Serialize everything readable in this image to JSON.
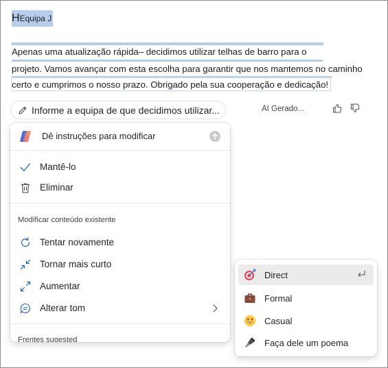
{
  "document": {
    "title_initial": "H",
    "title_rest": "Equipa J",
    "lines": [
      "Apenas uma atualização rápida– decidimos utilizar telhas de barro para o",
      "projeto. Vamos avançar com esta escolha para garantir que nos mantemos no caminho",
      "certo e cumprimos o nosso prazo. Obrigado pela sua cooperação e dedicação!"
    ]
  },
  "prompt": {
    "text": "Informe a equipa de que decidimos utilizar...",
    "ai_label": "AI Gerado..."
  },
  "menu": {
    "instruction_placeholder": "Dê instruções para modificar",
    "keep_label": "Mantê-lo",
    "delete_label": "Eliminar",
    "modify_section_label": "Modificar conteúdo existente",
    "retry_label": "Tentar novamente",
    "shorter_label": "Tornar mais curto",
    "expand_label": "Aumentar",
    "tone_label": "Alterar tom",
    "suggested_section_label": "Frentes sugested"
  },
  "tone_menu": {
    "items": [
      {
        "label": "Direct",
        "icon": "target-icon",
        "active": true
      },
      {
        "label": "Formal",
        "icon": "briefcase-icon"
      },
      {
        "label": "Casual",
        "icon": "grinning-face-icon"
      },
      {
        "label": "Faça dele um poema",
        "icon": "fountain-pen-icon"
      }
    ]
  },
  "colors": {
    "selection_highlight": "#b7cdec",
    "accent": "#0f6cbd"
  }
}
